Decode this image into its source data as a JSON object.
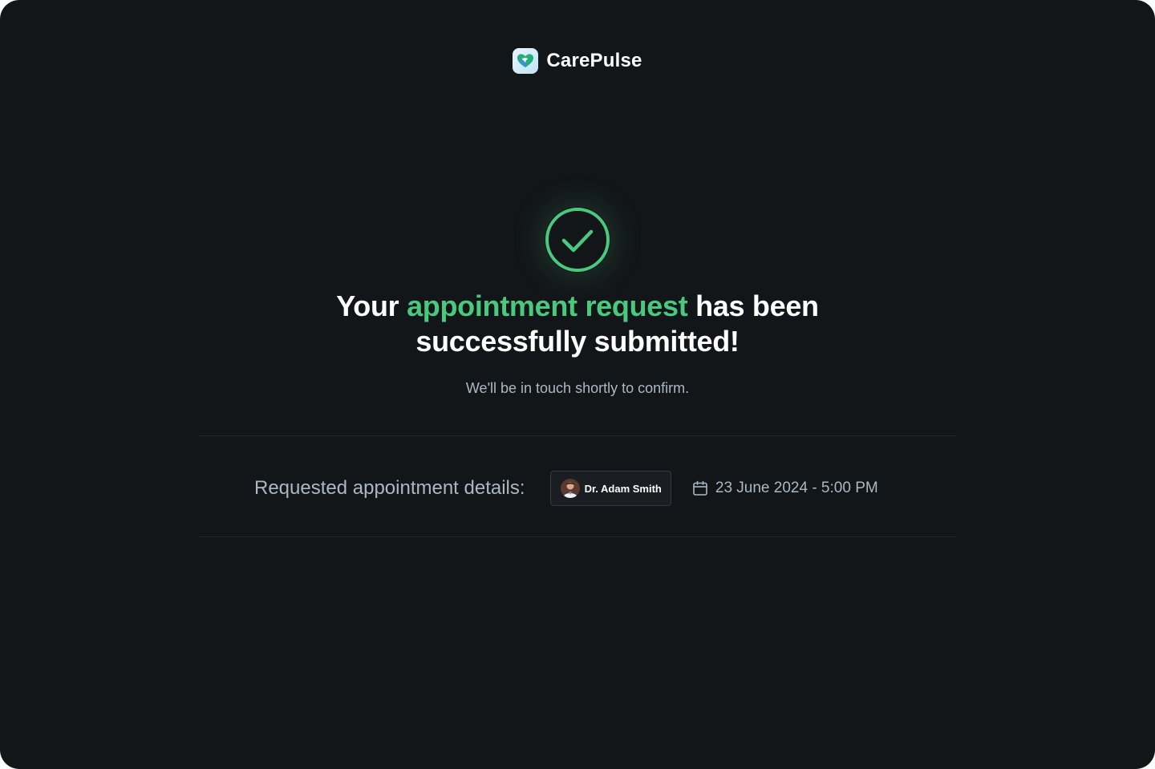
{
  "brand": {
    "name": "CarePulse",
    "logo_icon": "heart-pulse-logo"
  },
  "success": {
    "icon": "check-circle-icon",
    "headline_prefix": "Your",
    "headline_accent": "appointment request",
    "headline_suffix": "has been successfully submitted!",
    "subtext": "We'll be in touch shortly to confirm."
  },
  "details": {
    "label": "Requested appointment details:",
    "doctor_name": "Dr. Adam Smith",
    "doctor_avatar": "doctor-avatar",
    "calendar_icon": "calendar-icon",
    "datetime": "23 June 2024 - 5:00 PM"
  },
  "colors": {
    "background": "#131619",
    "accent": "#4ac97e",
    "muted_text": "#abb8c4",
    "chip_border": "#363a3d",
    "divider": "#24282d"
  }
}
